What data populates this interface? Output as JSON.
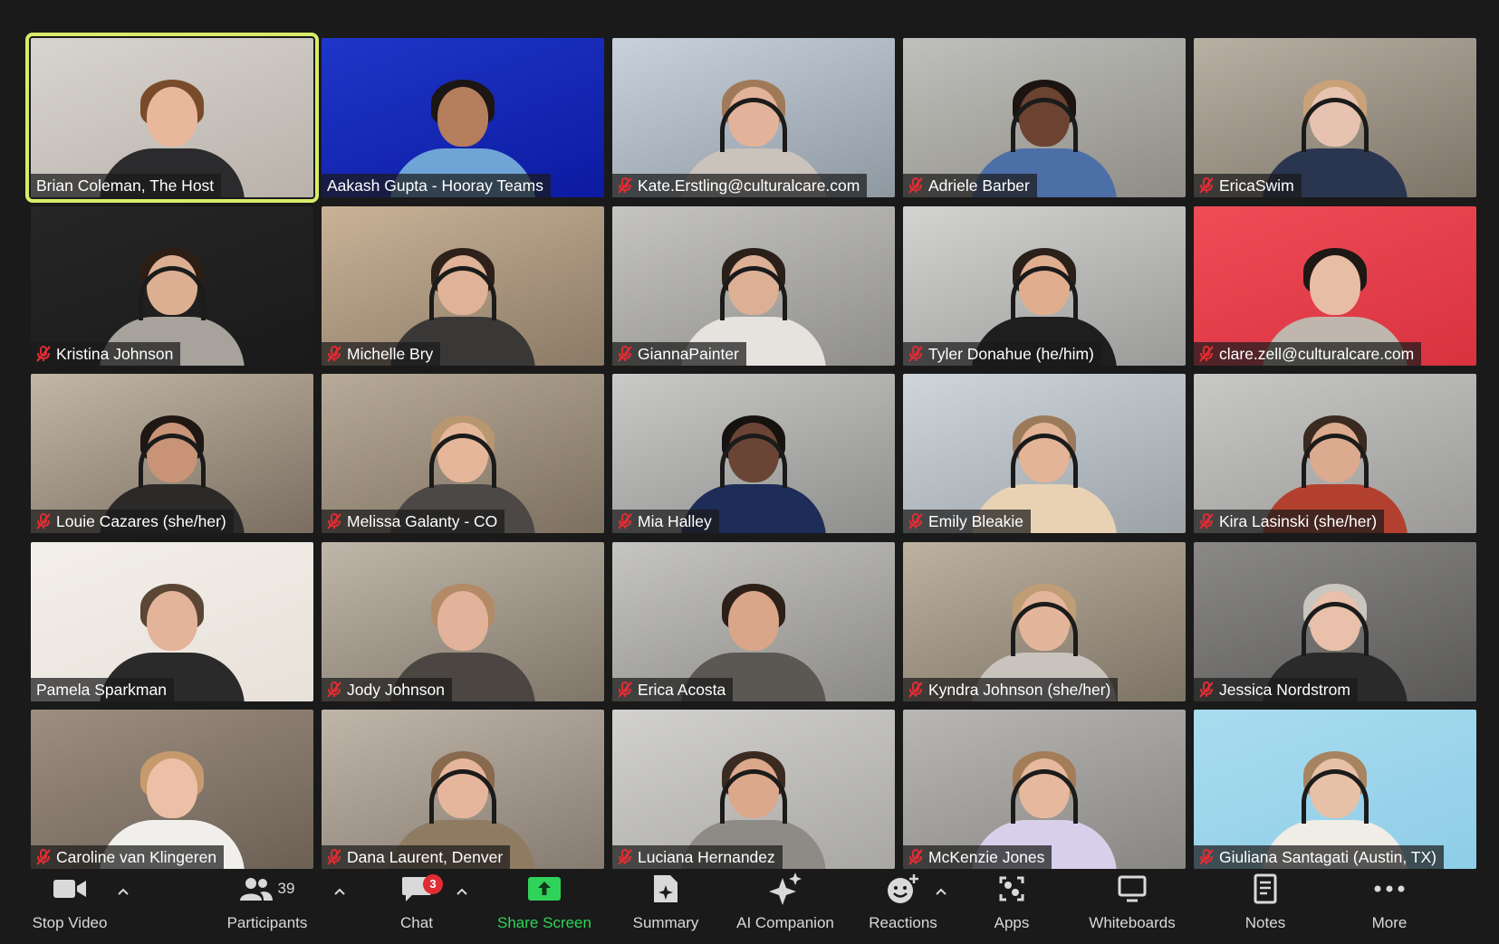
{
  "participants": [
    {
      "name": "Brian Coleman, The Host",
      "muted": false,
      "host": true,
      "bg": [
        "#d8d4cf",
        "#b8b2aa"
      ],
      "skin": "#e8b79c",
      "hair": "#7a4b2a",
      "shirt": "#2b2a2c",
      "headset": false
    },
    {
      "name": "Aakash Gupta - Hooray Teams",
      "muted": false,
      "host": false,
      "bg": [
        "#1f36c9",
        "#0c1aa0"
      ],
      "skin": "#b57e5c",
      "hair": "#1c1614",
      "shirt": "#6fa5d6",
      "headset": false
    },
    {
      "name": "Kate.Erstling@culturalcare.com",
      "muted": true,
      "host": false,
      "bg": [
        "#c9d2dc",
        "#8e98a1"
      ],
      "skin": "#e2b39a",
      "hair": "#a07a58",
      "shirt": "#c9c3bb",
      "headset": true
    },
    {
      "name": "Adriele Barber",
      "muted": true,
      "host": false,
      "bg": [
        "#bfc0bc",
        "#8f8c86"
      ],
      "skin": "#6b4330",
      "hair": "#1c1410",
      "shirt": "#4c6fa8",
      "headset": true
    },
    {
      "name": "EricaSwim",
      "muted": true,
      "host": false,
      "bg": [
        "#b9b0a4",
        "#7d7468"
      ],
      "skin": "#e7c2b0",
      "hair": "#c9a27a",
      "shirt": "#2a3550",
      "headset": true
    },
    {
      "name": "Kristina Johnson",
      "muted": true,
      "host": false,
      "bg": [
        "#262626",
        "#1a1a1a"
      ],
      "skin": "#dcae92",
      "hair": "#2c1d15",
      "shirt": "#a7a29b",
      "headset": true
    },
    {
      "name": "Michelle Bry",
      "muted": true,
      "host": false,
      "bg": [
        "#c9b297",
        "#8b7a66"
      ],
      "skin": "#e0b297",
      "hair": "#2d2119",
      "shirt": "#3a3837",
      "headset": true
    },
    {
      "name": "GiannaPainter",
      "muted": true,
      "host": false,
      "bg": [
        "#c5c4c0",
        "#8f8e8a"
      ],
      "skin": "#dcb095",
      "hair": "#2a2019",
      "shirt": "#e6e3de",
      "headset": true
    },
    {
      "name": "Tyler Donahue (he/him)",
      "muted": true,
      "host": false,
      "bg": [
        "#d3d4d2",
        "#9a9b99"
      ],
      "skin": "#e0ae8f",
      "hair": "#2b2019",
      "shirt": "#1e1e1e",
      "headset": true
    },
    {
      "name": "clare.zell@culturalcare.com",
      "muted": true,
      "host": false,
      "bg": [
        "#ef4c58",
        "#d8323f"
      ],
      "skin": "#e8bda6",
      "hair": "#1e1814",
      "shirt": "#bfb6ad",
      "headset": false
    },
    {
      "name": "Louie Cazares (she/her)",
      "muted": true,
      "host": false,
      "bg": [
        "#c2b6a6",
        "#7a6e60"
      ],
      "skin": "#c99377",
      "hair": "#1e1713",
      "shirt": "#2c2a28",
      "headset": true
    },
    {
      "name": "Melissa Galanty - CO",
      "muted": true,
      "host": false,
      "bg": [
        "#b7aa98",
        "#7d7060"
      ],
      "skin": "#e6b69b",
      "hair": "#b89670",
      "shirt": "#4b4845",
      "headset": true
    },
    {
      "name": "Mia Halley",
      "muted": true,
      "host": false,
      "bg": [
        "#c9cac8",
        "#8e8f8d"
      ],
      "skin": "#6a4535",
      "hair": "#151210",
      "shirt": "#1e2c58",
      "headset": true
    },
    {
      "name": "Emily Bleakie",
      "muted": true,
      "host": false,
      "bg": [
        "#cfd5da",
        "#9aa2a8"
      ],
      "skin": "#e4b498",
      "hair": "#9b7a5a",
      "shirt": "#e9d2b4",
      "headset": true
    },
    {
      "name": "Kira Lasinski (she/her)",
      "muted": true,
      "host": false,
      "bg": [
        "#c8c8c6",
        "#9a9997"
      ],
      "skin": "#dcaa8e",
      "hair": "#3a2a20",
      "shirt": "#b3402f",
      "headset": true
    },
    {
      "name": "Pamela Sparkman",
      "muted": false,
      "host": false,
      "bg": [
        "#f3efe9",
        "#e7e1d9"
      ],
      "skin": "#e3b39a",
      "hair": "#5b4535",
      "shirt": "#2a2a2a",
      "headset": false
    },
    {
      "name": "Jody Johnson",
      "muted": true,
      "host": false,
      "bg": [
        "#bfb6aa",
        "#7f7669"
      ],
      "skin": "#e2b29a",
      "hair": "#b28a66",
      "shirt": "#4b4642",
      "headset": false
    },
    {
      "name": "Erica Acosta",
      "muted": true,
      "host": false,
      "bg": [
        "#c6c5c2",
        "#8b8a86"
      ],
      "skin": "#d9a68a",
      "hair": "#2b1f18",
      "shirt": "#5b5753",
      "headset": false
    },
    {
      "name": "Kyndra Johnson (she/her)",
      "muted": true,
      "host": false,
      "bg": [
        "#bdb1a0",
        "#7d7364"
      ],
      "skin": "#e3b69c",
      "hair": "#c09d74",
      "shirt": "#c8c3bd",
      "headset": true
    },
    {
      "name": "Jessica Nordstrom",
      "muted": true,
      "host": false,
      "bg": [
        "#8a8987",
        "#5a5957"
      ],
      "skin": "#e9c0a9",
      "hair": "#c9c5bf",
      "shirt": "#2a2a2a",
      "headset": true
    },
    {
      "name": "Caroline van Klingeren",
      "muted": true,
      "host": false,
      "bg": [
        "#9c8e80",
        "#6c6055"
      ],
      "skin": "#ecc0a6",
      "hair": "#c79a6e",
      "shirt": "#f0efec",
      "headset": false
    },
    {
      "name": "Dana Laurent, Denver",
      "muted": true,
      "host": false,
      "bg": [
        "#bfb5a9",
        "#857b70"
      ],
      "skin": "#e6b69c",
      "hair": "#8a6a4e",
      "shirt": "#8f7b62",
      "headset": true
    },
    {
      "name": "Luciana Hernandez",
      "muted": true,
      "host": false,
      "bg": [
        "#d2d1ce",
        "#a8a7a4"
      ],
      "skin": "#dca88c",
      "hair": "#3a2a20",
      "shirt": "#8e8b87",
      "headset": true
    },
    {
      "name": "McKenzie Jones",
      "muted": true,
      "host": false,
      "bg": [
        "#b9b7b3",
        "#888682"
      ],
      "skin": "#e6b89d",
      "hair": "#a37c58",
      "shirt": "#d8d0ea",
      "headset": true
    },
    {
      "name": "Giuliana Santagati (Austin, TX)",
      "muted": true,
      "host": false,
      "bg": [
        "#a9dcef",
        "#8ecde8"
      ],
      "skin": "#e7c0a8",
      "hair": "#a68460",
      "shirt": "#f0ece6",
      "headset": true
    }
  ],
  "toolbar": {
    "stop_video": "Stop Video",
    "participants": "Participants",
    "participant_count": "39",
    "chat": "Chat",
    "chat_badge": "3",
    "share_screen": "Share Screen",
    "summary": "Summary",
    "ai_companion": "AI Companion",
    "reactions": "Reactions",
    "apps": "Apps",
    "whiteboards": "Whiteboards",
    "notes": "Notes",
    "more": "More"
  },
  "colors": {
    "share_green": "#2fd35a",
    "host_border": "#d8ec6a",
    "mute_red": "#e02c33",
    "badge_red": "#e02c33"
  }
}
